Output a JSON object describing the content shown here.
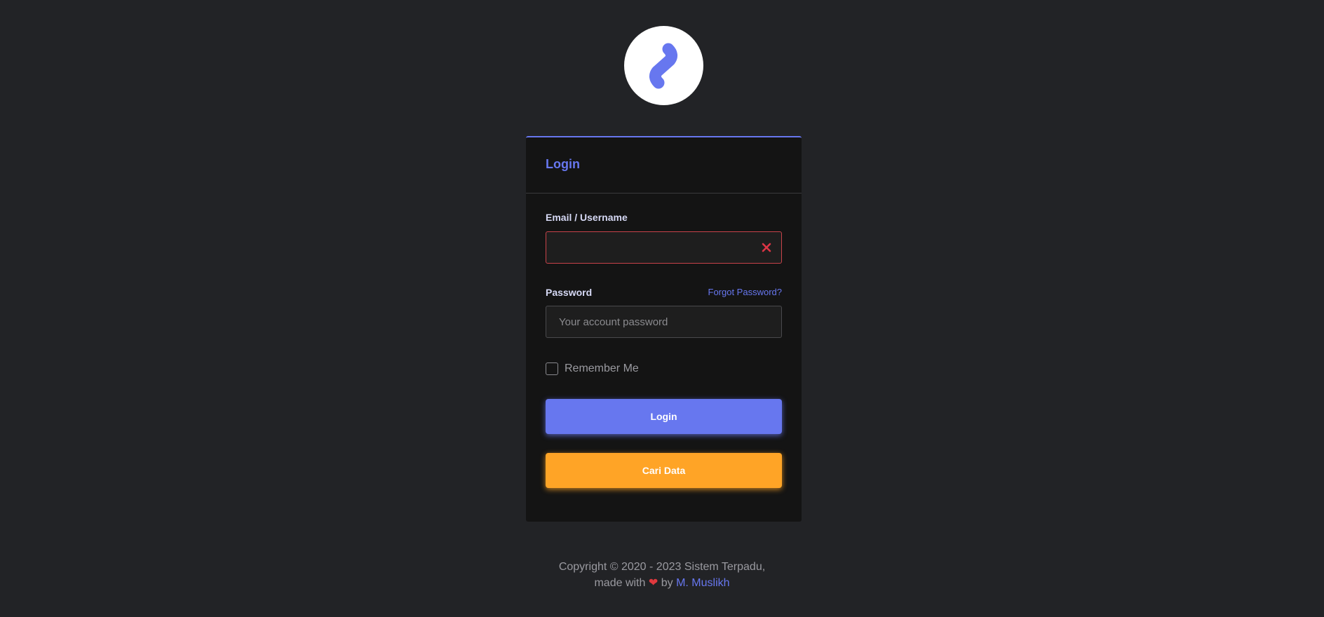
{
  "logo": {
    "letter_icon": "s-logo-icon",
    "accent": "#6777ef"
  },
  "card": {
    "title": "Login",
    "email_label": "Email / Username",
    "email_value": "",
    "password_label": "Password",
    "forgot_link": "Forgot Password?",
    "password_placeholder": "Your account password",
    "remember_label": "Remember Me",
    "login_button": "Login",
    "search_button": "Cari Data"
  },
  "footer": {
    "copyright": "Copyright © 2020 - 2023 Sistem Terpadu,",
    "made_with": "made with",
    "heart": "❤",
    "by": "by",
    "author": "M. Muslikh"
  },
  "colors": {
    "primary": "#6777ef",
    "warning": "#ffa426",
    "error": "#c9434a",
    "background": "#222326",
    "card": "#141414"
  }
}
